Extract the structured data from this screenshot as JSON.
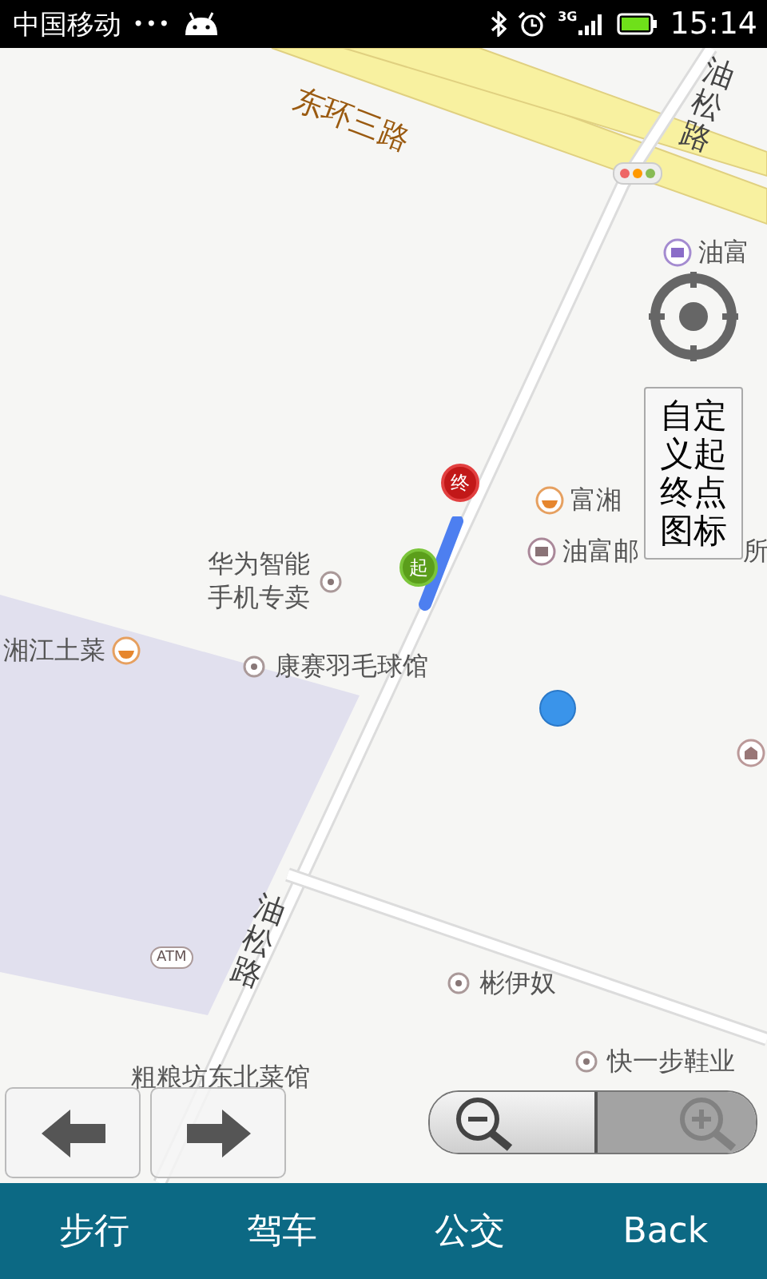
{
  "status_bar": {
    "carrier": "中国移动",
    "dots": "•••",
    "network": "3G",
    "time": "15:14"
  },
  "map": {
    "labels": [
      {
        "kind": "road",
        "text": "东环三路"
      },
      {
        "kind": "road-vertical",
        "text": "油松路"
      },
      {
        "kind": "poi",
        "text": "油富"
      },
      {
        "kind": "poi",
        "text": "富湘"
      },
      {
        "kind": "poi",
        "text": "华为智能手机专卖"
      },
      {
        "kind": "poi",
        "text": "油富邮"
      },
      {
        "kind": "fragment",
        "text": "所"
      },
      {
        "kind": "poi",
        "text": "湘江土菜"
      },
      {
        "kind": "poi",
        "text": "康赛羽毛球馆"
      },
      {
        "kind": "road-vertical",
        "text": "油松路"
      },
      {
        "kind": "atm",
        "text": "ATM"
      },
      {
        "kind": "poi",
        "text": "彬伊奴"
      },
      {
        "kind": "poi",
        "text": "快一步鞋业"
      },
      {
        "kind": "poi",
        "text": "粗粮坊东北菜馆"
      }
    ],
    "start_marker": "起",
    "end_marker": "终",
    "custom_button": "自定义起终点图标",
    "zoom": {
      "zoom_out": {
        "disabled": false
      },
      "zoom_in": {
        "disabled": true
      }
    }
  },
  "nav": [
    {
      "label": "步行"
    },
    {
      "label": "驾车"
    },
    {
      "label": "公交"
    },
    {
      "label": "Back"
    }
  ]
}
